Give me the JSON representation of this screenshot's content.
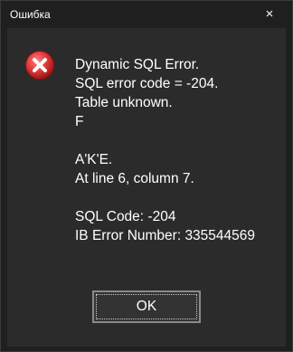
{
  "window": {
    "title": "Ошибка",
    "close_glyph": "×"
  },
  "icon": {
    "name": "error-icon",
    "color": "#d42e2e"
  },
  "message": {
    "lines": [
      "Dynamic SQL Error.",
      "SQL error code = -204.",
      "Table unknown.",
      "F",
      "",
      "A'K'E.",
      "At line 6, column 7.",
      "",
      "SQL Code: -204",
      "IB Error Number: 335544569"
    ]
  },
  "buttons": {
    "ok_label": "OK"
  }
}
